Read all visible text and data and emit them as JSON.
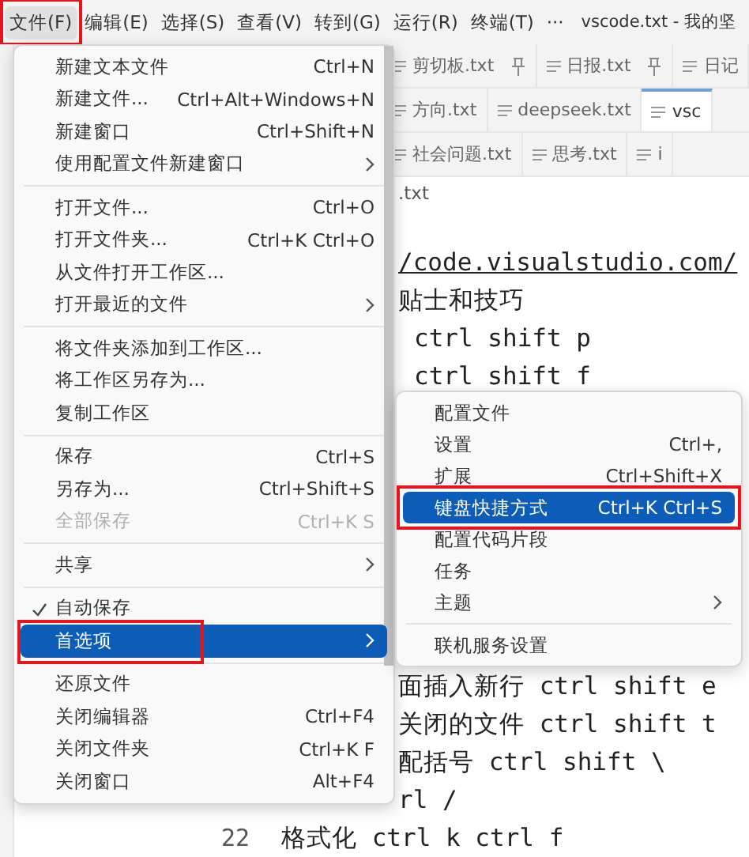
{
  "menubar": {
    "items": [
      {
        "label": "文件(F)",
        "selected": true,
        "annotated": true
      },
      {
        "label": "编辑(E)",
        "selected": false,
        "annotated": false
      },
      {
        "label": "选择(S)",
        "selected": false,
        "annotated": false
      },
      {
        "label": "查看(V)",
        "selected": false,
        "annotated": false
      },
      {
        "label": "转到(G)",
        "selected": false,
        "annotated": false
      },
      {
        "label": "运行(R)",
        "selected": false,
        "annotated": false
      },
      {
        "label": "终端(T)",
        "selected": false,
        "annotated": false
      },
      {
        "label": "···",
        "selected": false,
        "annotated": false
      }
    ],
    "title": "vscode.txt - 我的坚"
  },
  "tab_rows": [
    [
      {
        "label": "剪切板.txt",
        "pinned": true,
        "selected": false
      },
      {
        "label": "日报.txt",
        "pinned": true,
        "selected": false
      },
      {
        "label": "日记",
        "pinned": false,
        "selected": false
      }
    ],
    [
      {
        "label": "方向.txt",
        "pinned": false,
        "selected": false
      },
      {
        "label": "deepseek.txt",
        "pinned": false,
        "selected": false
      },
      {
        "label": "vsc",
        "pinned": false,
        "selected": true
      }
    ],
    [
      {
        "label": "社会问题.txt",
        "pinned": false,
        "selected": false
      },
      {
        "label": "思考.txt",
        "pinned": false,
        "selected": false
      },
      {
        "label": "i",
        "pinned": false,
        "selected": false
      }
    ]
  ],
  "breadcrumb": ".txt",
  "editor": {
    "upper_lines": [
      {
        "kind": "link",
        "text": "/code.visualstudio.com/"
      },
      {
        "kind": "text",
        "text": "贴士和技巧"
      },
      {
        "kind": "indented",
        "text": "ctrl shift p"
      },
      {
        "kind": "indented",
        "text": "ctrl shift f"
      }
    ],
    "lower_lines": [
      {
        "kind": "text",
        "text": "面插入新行 ctrl shift e"
      },
      {
        "kind": "text",
        "text": "关闭的文件 ctrl shift t"
      },
      {
        "kind": "text",
        "text": "配括号 ctrl shift \\"
      },
      {
        "kind": "text",
        "text": "rl /"
      },
      {
        "kind": "numbered",
        "number": "22",
        "text": "格式化 ctrl k ctrl f"
      }
    ]
  },
  "file_menu": {
    "groups": [
      [
        {
          "label": "新建文本文件",
          "shortcut": "Ctrl+N",
          "submenu": false,
          "checked": false,
          "disabled": false,
          "selected": false,
          "annotated": false
        },
        {
          "label": "新建文件...",
          "shortcut": "Ctrl+Alt+Windows+N",
          "submenu": false,
          "checked": false,
          "disabled": false,
          "selected": false,
          "annotated": false
        },
        {
          "label": "新建窗口",
          "shortcut": "Ctrl+Shift+N",
          "submenu": false,
          "checked": false,
          "disabled": false,
          "selected": false,
          "annotated": false
        },
        {
          "label": "使用配置文件新建窗口",
          "submenu": true,
          "checked": false,
          "disabled": false,
          "selected": false,
          "annotated": false
        }
      ],
      [
        {
          "label": "打开文件...",
          "shortcut": "Ctrl+O",
          "submenu": false,
          "checked": false,
          "disabled": false,
          "selected": false,
          "annotated": false
        },
        {
          "label": "打开文件夹...",
          "shortcut": "Ctrl+K Ctrl+O",
          "submenu": false,
          "checked": false,
          "disabled": false,
          "selected": false,
          "annotated": false
        },
        {
          "label": "从文件打开工作区...",
          "submenu": false,
          "checked": false,
          "disabled": false,
          "selected": false,
          "annotated": false
        },
        {
          "label": "打开最近的文件",
          "submenu": true,
          "checked": false,
          "disabled": false,
          "selected": false,
          "annotated": false
        }
      ],
      [
        {
          "label": "将文件夹添加到工作区...",
          "submenu": false,
          "checked": false,
          "disabled": false,
          "selected": false,
          "annotated": false
        },
        {
          "label": "将工作区另存为...",
          "submenu": false,
          "checked": false,
          "disabled": false,
          "selected": false,
          "annotated": false
        },
        {
          "label": "复制工作区",
          "submenu": false,
          "checked": false,
          "disabled": false,
          "selected": false,
          "annotated": false
        }
      ],
      [
        {
          "label": "保存",
          "shortcut": "Ctrl+S",
          "submenu": false,
          "checked": false,
          "disabled": false,
          "selected": false,
          "annotated": false
        },
        {
          "label": "另存为...",
          "shortcut": "Ctrl+Shift+S",
          "submenu": false,
          "checked": false,
          "disabled": false,
          "selected": false,
          "annotated": false
        },
        {
          "label": "全部保存",
          "shortcut": "Ctrl+K S",
          "submenu": false,
          "checked": false,
          "disabled": true,
          "selected": false,
          "annotated": false
        }
      ],
      [
        {
          "label": "共享",
          "submenu": true,
          "checked": false,
          "disabled": false,
          "selected": false,
          "annotated": false
        }
      ],
      [
        {
          "label": "自动保存",
          "submenu": false,
          "checked": true,
          "disabled": false,
          "selected": false,
          "annotated": false
        },
        {
          "label": "首选项",
          "submenu": true,
          "checked": false,
          "disabled": false,
          "selected": true,
          "annotated": true
        }
      ],
      [
        {
          "label": "还原文件",
          "submenu": false,
          "checked": false,
          "disabled": false,
          "selected": false,
          "annotated": false
        },
        {
          "label": "关闭编辑器",
          "shortcut": "Ctrl+F4",
          "submenu": false,
          "checked": false,
          "disabled": false,
          "selected": false,
          "annotated": false
        },
        {
          "label": "关闭文件夹",
          "shortcut": "Ctrl+K F",
          "submenu": false,
          "checked": false,
          "disabled": false,
          "selected": false,
          "annotated": false
        },
        {
          "label": "关闭窗口",
          "shortcut": "Alt+F4",
          "submenu": false,
          "checked": false,
          "disabled": false,
          "selected": false,
          "annotated": false
        }
      ]
    ]
  },
  "preferences_menu": {
    "groups": [
      [
        {
          "label": "配置文件",
          "submenu": false,
          "checked": false,
          "disabled": false,
          "selected": false,
          "annotated": false
        },
        {
          "label": "设置",
          "shortcut": "Ctrl+,",
          "submenu": false,
          "checked": false,
          "disabled": false,
          "selected": false,
          "annotated": false
        },
        {
          "label": "扩展",
          "shortcut": "Ctrl+Shift+X",
          "submenu": false,
          "checked": false,
          "disabled": false,
          "selected": false,
          "annotated": false
        },
        {
          "label": "键盘快捷方式",
          "shortcut": "Ctrl+K Ctrl+S",
          "submenu": false,
          "checked": false,
          "disabled": false,
          "selected": true,
          "annotated": true
        },
        {
          "label": "配置代码片段",
          "submenu": false,
          "checked": false,
          "disabled": false,
          "selected": false,
          "annotated": false
        },
        {
          "label": "任务",
          "submenu": false,
          "checked": false,
          "disabled": false,
          "selected": false,
          "annotated": false
        },
        {
          "label": "主题",
          "submenu": true,
          "checked": false,
          "disabled": false,
          "selected": false,
          "annotated": false
        }
      ],
      [
        {
          "label": "联机服务设置",
          "submenu": false,
          "checked": false,
          "disabled": false,
          "selected": false,
          "annotated": false
        }
      ]
    ]
  }
}
